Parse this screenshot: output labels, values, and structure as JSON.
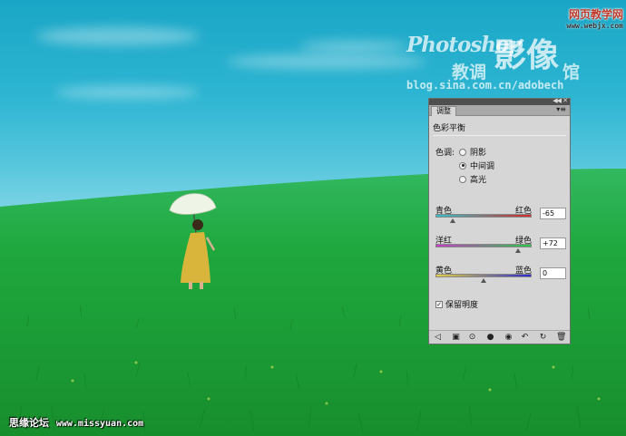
{
  "watermark": {
    "photoshop": "Photoshop",
    "ying_xiang": "影像",
    "jiao_tiao": "教调",
    "guan": "馆",
    "blog": "blog.sina.com.cn/adobech",
    "site_cn": "网页教学网",
    "site_url": "www.webjx.com",
    "bottom_cn": "思缘论坛",
    "bottom_url": "www.missyuan.com"
  },
  "panel": {
    "tab": "调整",
    "title": "色彩平衡",
    "tone_label": "色调:",
    "tones": [
      {
        "label": "阴影",
        "checked": false
      },
      {
        "label": "中间调",
        "checked": true
      },
      {
        "label": "高光",
        "checked": false
      }
    ],
    "sliders": [
      {
        "left": "青色",
        "right": "红色",
        "value": "-65",
        "amount": -65,
        "colors": [
          "#34c0c8",
          "#d42a2a"
        ]
      },
      {
        "left": "洋红",
        "right": "绿色",
        "value": "+72",
        "amount": 72,
        "colors": [
          "#c83cc8",
          "#2ac846"
        ]
      },
      {
        "left": "黄色",
        "right": "蓝色",
        "value": "0",
        "amount": 0,
        "colors": [
          "#e6d23c",
          "#2a2ad2"
        ]
      }
    ],
    "preserve_label": "保留明度",
    "preserve_checked": true,
    "footer_icons": [
      "back-arrow-icon",
      "view-mode-icon",
      "clip-layer-icon",
      "visibility-eye-icon",
      "eye-icon",
      "previous-state-icon",
      "reset-icon",
      "trash-icon"
    ]
  },
  "colors": {
    "sky": "#1ea9c8",
    "grass": "#1fa83e",
    "panel_bg": "#d6d6d6"
  }
}
